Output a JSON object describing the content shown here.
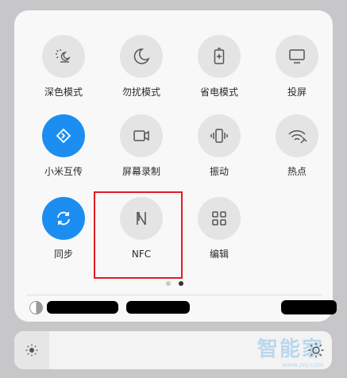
{
  "tiles": [
    {
      "name": "dark-mode",
      "label": "深色模式",
      "icon": "dark-mode-icon",
      "active": false
    },
    {
      "name": "do-not-disturb",
      "label": "勿扰模式",
      "icon": "moon-icon",
      "active": false
    },
    {
      "name": "power-saving",
      "label": "省电模式",
      "icon": "battery-icon",
      "active": false
    },
    {
      "name": "screen-cast",
      "label": "投屏",
      "icon": "monitor-icon",
      "active": false
    },
    {
      "name": "mi-share",
      "label": "小米互传",
      "icon": "mi-share-icon",
      "active": true
    },
    {
      "name": "screen-record",
      "label": "屏幕录制",
      "icon": "video-camera-icon",
      "active": false
    },
    {
      "name": "vibrate",
      "label": "振动",
      "icon": "vibrate-icon",
      "active": false
    },
    {
      "name": "hotspot",
      "label": "热点",
      "icon": "hotspot-icon",
      "active": false
    },
    {
      "name": "auto-rotate",
      "label": "同步",
      "icon": "sync-icon",
      "active": true
    },
    {
      "name": "nfc",
      "label": "NFC",
      "icon": "nfc-icon",
      "active": false
    },
    {
      "name": "edit",
      "label": "编辑",
      "icon": "grid-icon",
      "active": false
    }
  ],
  "pager": {
    "pages": 2,
    "current": 2
  },
  "watermark": {
    "text": "智能家",
    "sub": "www.znj.com"
  },
  "colors": {
    "accent": "#1c8ef2",
    "highlight": "#e21c25"
  }
}
